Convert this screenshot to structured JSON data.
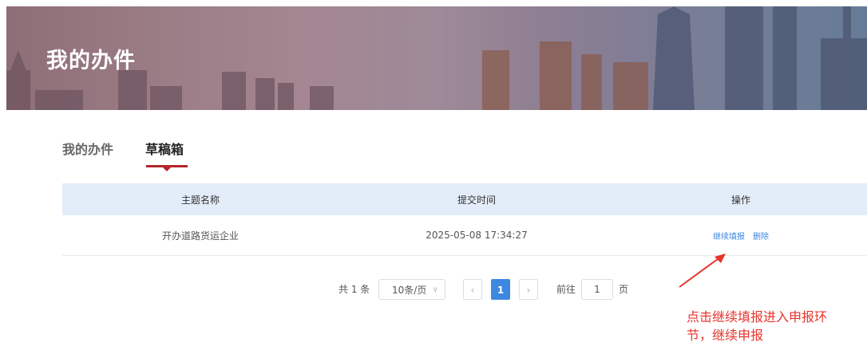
{
  "banner": {
    "title": "我的办件"
  },
  "tabs": [
    {
      "label": "我的办件"
    },
    {
      "label": "草稿箱"
    }
  ],
  "table": {
    "headers": [
      "主题名称",
      "提交时间",
      "操作"
    ],
    "rows": [
      {
        "name": "开办道路货运企业",
        "time": "2025-05-08 17:34:27",
        "actions": [
          "继续填报",
          "删除"
        ]
      }
    ]
  },
  "pagination": {
    "total": "共 1 条",
    "page_size": "10条/页",
    "current_page": "1",
    "goto_label": "前往",
    "goto_value": "1",
    "goto_unit": "页"
  },
  "annotation": {
    "line1": "点击继续填报进入申报环",
    "line2": "节，继续申报"
  },
  "colors": {
    "accent_red": "#b3262c",
    "link_blue": "#3d88e0",
    "header_bg": "#e3edf9",
    "annotation_red": "#e8332c"
  }
}
